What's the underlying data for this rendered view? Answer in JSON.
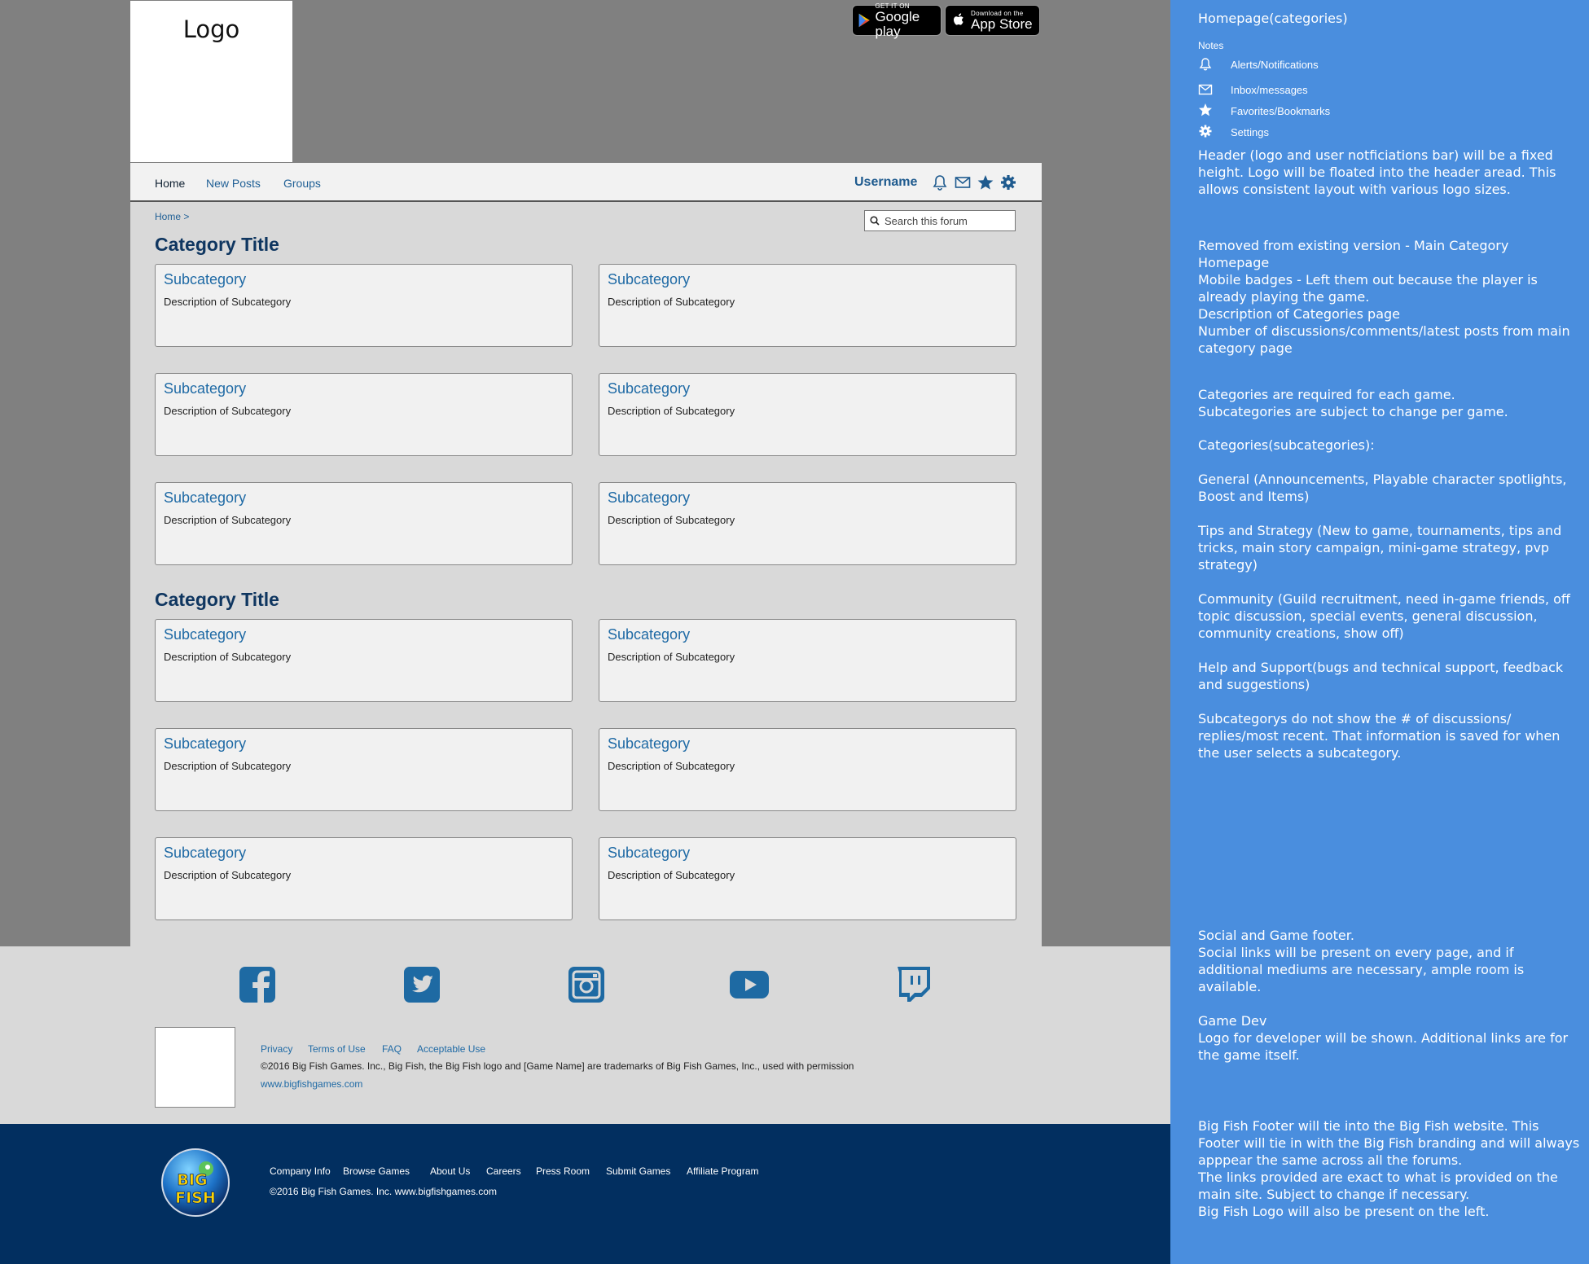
{
  "header": {
    "logo_text": "Logo",
    "google_play": {
      "small": "GET IT ON",
      "big": "Google play"
    },
    "app_store": {
      "small": "Download on the",
      "big": "App Store"
    }
  },
  "nav": {
    "links": [
      "Home",
      "New Posts",
      "Groups"
    ],
    "username": "Username",
    "icons": [
      "bell-icon",
      "envelope-icon",
      "star-icon",
      "gear-icon"
    ]
  },
  "breadcrumb": "Home >",
  "search": {
    "placeholder": "Search this forum"
  },
  "categories": [
    {
      "title": "Category Title",
      "subcategories": [
        {
          "title": "Subcategory",
          "desc": "Description of Subcategory"
        },
        {
          "title": "Subcategory",
          "desc": "Description of Subcategory"
        },
        {
          "title": "Subcategory",
          "desc": "Description of Subcategory"
        },
        {
          "title": "Subcategory",
          "desc": "Description of Subcategory"
        },
        {
          "title": "Subcategory",
          "desc": "Description of Subcategory"
        },
        {
          "title": "Subcategory",
          "desc": "Description of Subcategory"
        }
      ]
    },
    {
      "title": "Category Title",
      "subcategories": [
        {
          "title": "Subcategory",
          "desc": "Description of Subcategory"
        },
        {
          "title": "Subcategory",
          "desc": "Description of Subcategory"
        },
        {
          "title": "Subcategory",
          "desc": "Description of Subcategory"
        },
        {
          "title": "Subcategory",
          "desc": "Description of Subcategory"
        },
        {
          "title": "Subcategory",
          "desc": "Description of Subcategory"
        },
        {
          "title": "Subcategory",
          "desc": "Description of Subcategory"
        }
      ]
    }
  ],
  "social_footer": {
    "icons": [
      "facebook-icon",
      "twitter-icon",
      "instagram-icon",
      "youtube-icon",
      "twitch-icon"
    ],
    "links": [
      "Privacy",
      "Terms of Use",
      "FAQ",
      "Acceptable Use"
    ],
    "copyright": "©2016 Big Fish Games. Inc., Big Fish, the Big Fish logo and [Game Name] are trademarks of Big Fish Games, Inc., used with permission",
    "site": "www.bigfishgames.com"
  },
  "bigfish_footer": {
    "logo_text": "BIG FISH",
    "links": [
      "Company Info",
      "Browse Games",
      "About Us",
      "Careers",
      "Press Room",
      "Submit Games",
      "Affiliate Program"
    ],
    "copyright": "©2016 Big Fish Games. Inc. www.bigfishgames.com"
  },
  "notes": {
    "title": "Homepage(categories)",
    "label": "Notes",
    "legend": [
      {
        "icon": "bell-icon",
        "text": "Alerts/Notifications"
      },
      {
        "icon": "envelope-icon",
        "text": "Inbox/messages"
      },
      {
        "icon": "star-icon",
        "text": "Favorites/Bookmarks"
      },
      {
        "icon": "gear-icon",
        "text": "Settings"
      }
    ],
    "blocks": [
      "Header (logo and user notficiations bar) will be a fixed height. Logo will be floated into the header aread. This allows consistent layout with various logo sizes.",
      "Removed from existing version - Main Category Homepage\nMobile badges - Left them out because the player is already playing the game.\nDescription of Categories page\nNumber of discussions/comments/latest posts from main category page",
      "Categories are required for each game.\nSubcategories are subject to change per game.",
      "Categories(subcategories):",
      "General (Announcements, Playable character spotlights, Boost and Items)",
      "Tips and Strategy (New to game, tournaments, tips and tricks, main story campaign, mini-game strategy, pvp strategy)",
      "Community (Guild recruitment, need in-game friends, off topic discussion, special events, general discussion, community creations, show off)",
      "Help and Support(bugs and technical support, feedback and suggestions)",
      "Subcategorys do not show the # of discussions/ replies/most recent. That information is saved for when the user selects a subcategory.",
      "Social and Game footer.\nSocial links will be present on every page, and if additional mediums are necessary, ample room is available.",
      "Game Dev\nLogo for developer will be shown. Additional links are for the game itself.",
      "Big Fish Footer will tie into the Big Fish website. This Footer will tie in with the Big Fish branding and will always apppear the same across all the forums.\nThe links provided are exact to what is provided on the main site. Subject to change if necessary.\nBig Fish Logo will also be present on the left."
    ]
  }
}
